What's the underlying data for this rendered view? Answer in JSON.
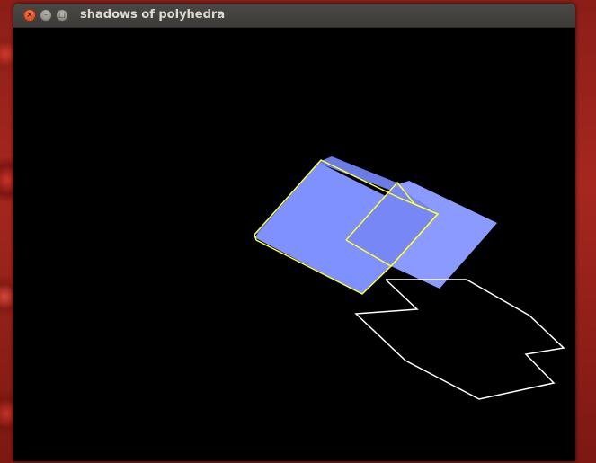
{
  "window": {
    "title": "shadows of polyhedra",
    "close_glyph": "×",
    "minimize_glyph": "–",
    "maximize_glyph": "□"
  },
  "scene": {
    "background": "#000000",
    "face_color": "#7f90ff",
    "face_shade_color": "#5e6fd8",
    "edge_color": "#ffff33",
    "shadow_outline_color": "#ffffff"
  }
}
